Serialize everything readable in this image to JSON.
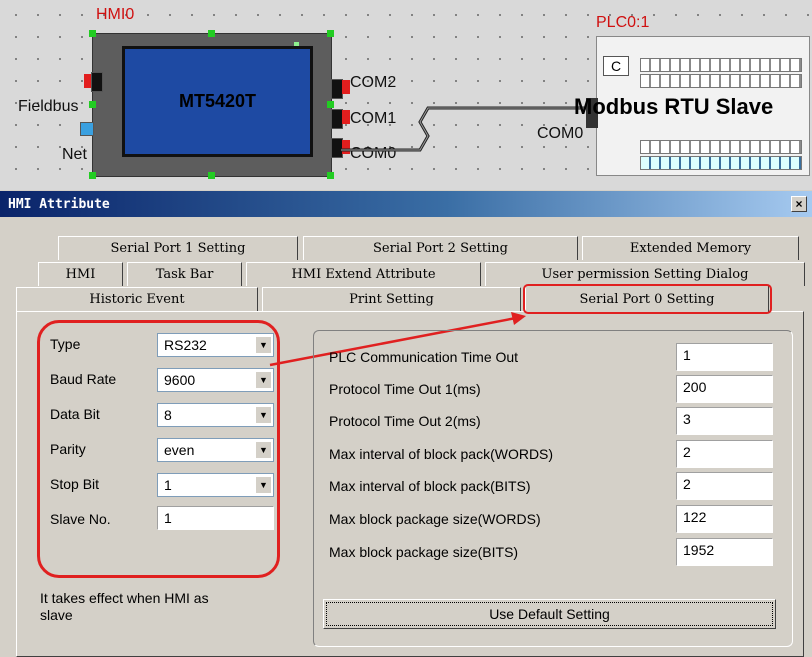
{
  "canvas": {
    "hmi_label": "HMI0",
    "hmi_model": "MT5420T",
    "fieldbus_label": "Fieldbus",
    "net_label": "Net",
    "com2_label": "COM2",
    "com1_label": "COM1",
    "com0_hmi_label": "COM0",
    "plc_label": "PLC0:1",
    "plc_com_label": "COM0",
    "plc_name": "Modbus RTU Slave"
  },
  "dialog": {
    "title": "HMI Attribute",
    "close_glyph": "×",
    "tabs_row1": [
      "Serial Port 1 Setting",
      "Serial Port 2 Setting",
      "Extended Memory"
    ],
    "tabs_row2": [
      "HMI",
      "Task Bar",
      "HMI Extend Attribute",
      "User permission Setting Dialog"
    ],
    "tabs_row3": [
      "Historic Event",
      "Print Setting",
      "Serial Port 0 Setting"
    ],
    "active_tab": "Serial Port 0 Setting",
    "left": {
      "type_label": "Type",
      "type_value": "RS232",
      "baud_label": "Baud Rate",
      "baud_value": "9600",
      "databit_label": "Data Bit",
      "databit_value": "8",
      "parity_label": "Parity",
      "parity_value": "even",
      "stopbit_label": "Stop Bit",
      "stopbit_value": "1",
      "slave_label": "Slave No.",
      "slave_value": "1",
      "note": "It takes effect when HMI as slave"
    },
    "right": {
      "plc_timeout_label": "PLC Communication Time Out",
      "plc_timeout_value": "1",
      "proto1_label": "Protocol Time Out 1(ms)",
      "proto1_value": "200",
      "proto2_label": "Protocol Time Out 2(ms)",
      "proto2_value": "3",
      "max_int_words_label": "Max interval of block pack(WORDS)",
      "max_int_words_value": "2",
      "max_int_bits_label": "Max interval of block pack(BITS)",
      "max_int_bits_value": "2",
      "max_pkg_words_label": "Max block package size(WORDS)",
      "max_pkg_words_value": "122",
      "max_pkg_bits_label": "Max block package size(BITS)",
      "max_pkg_bits_value": "1952",
      "default_button": "Use Default Setting"
    }
  },
  "colors": {
    "annotation_red": "#e02020",
    "title_bar": "#0a246a",
    "hmi_screen": "#1e4aa3",
    "handle_green": "#22cc22"
  }
}
